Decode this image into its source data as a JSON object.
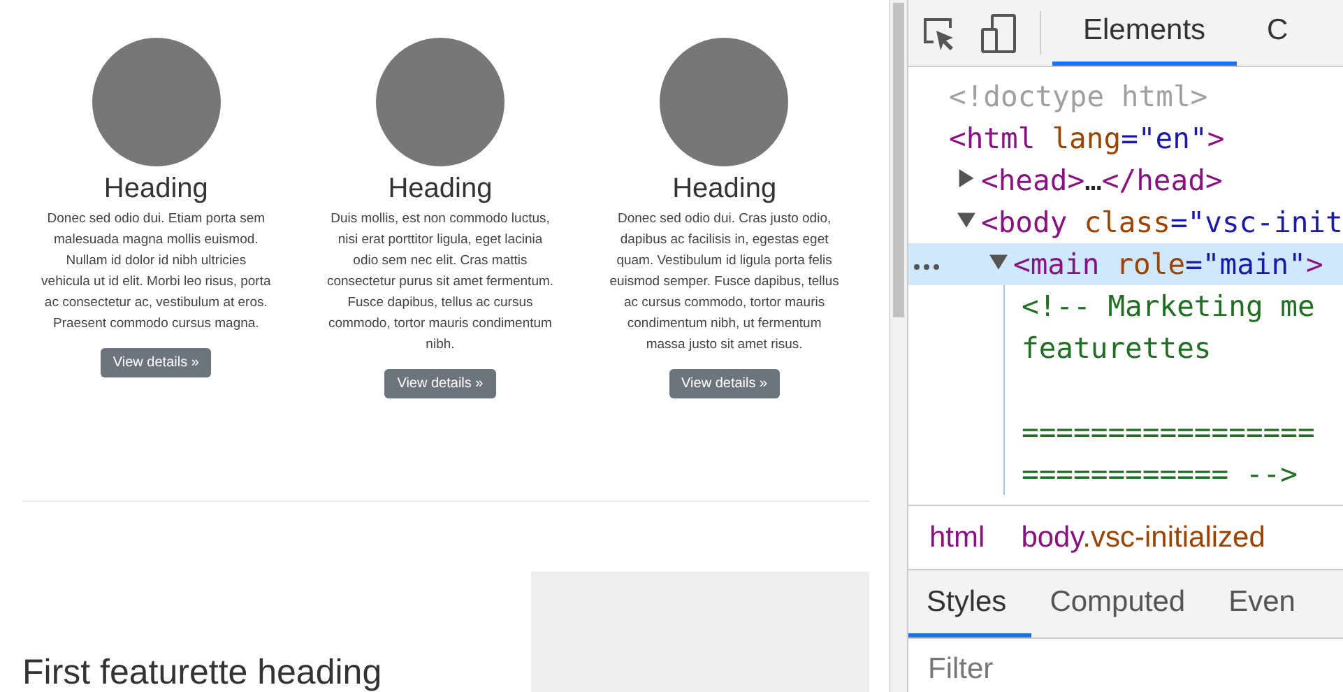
{
  "page": {
    "cards": [
      {
        "heading": "Heading",
        "text": "Donec sed odio dui. Etiam porta sem malesuada magna mollis euismod. Nullam id dolor id nibh ultricies vehicula ut id elit. Morbi leo risus, porta ac consectetur ac, vestibulum at eros. Praesent commodo cursus magna.",
        "button": "View details »"
      },
      {
        "heading": "Heading",
        "text": "Duis mollis, est non commodo luctus, nisi erat porttitor ligula, eget lacinia odio sem nec elit. Cras mattis consectetur purus sit amet fermentum. Fusce dapibus, tellus ac cursus commodo, tortor mauris condimentum nibh.",
        "button": "View details »"
      },
      {
        "heading": "Heading",
        "text": "Donec sed odio dui. Cras justo odio, dapibus ac facilisis in, egestas eget quam. Vestibulum id ligula porta felis euismod semper. Fusce dapibus, tellus ac cursus commodo, tortor mauris condimentum nibh, ut fermentum massa justo sit amet risus.",
        "button": "View details »"
      }
    ],
    "featurette_heading": "First featurette heading"
  },
  "devtools": {
    "tabs": [
      {
        "label": "Elements",
        "selected": true
      },
      {
        "label": "C",
        "selected": false
      }
    ],
    "tree": [
      {
        "doctype": "<!doctype html>",
        "selected": false
      },
      {
        "tag": "<html",
        "attributes": [
          {
            "name": "lang",
            "value": "=\"en\""
          }
        ],
        "end": ">",
        "selected": false,
        "children": [
          {
            "tag": "<head>",
            "content": "…",
            "closing": "</head>",
            "expanded": false,
            "selected": false
          },
          {
            "tag": "<body",
            "attributes": [
              {
                "name": "class",
                "value": "=\"vsc-init"
              }
            ],
            "expanded": true,
            "selected": false,
            "children": [
              {
                "tag": "<main",
                "attributes": [
                  {
                    "name": "role",
                    "value": "=\"main\""
                  }
                ],
                "end": ">",
                "expanded": true,
                "selected": true,
                "children": [
                  {
                    "comment_lines": [
                      {
                        "text": "<!-- Marketing me"
                      },
                      {
                        "text": "featurettes"
                      },
                      {
                        "text": "=================",
                        "blank_before": true
                      },
                      {
                        "text": "============ -->"
                      }
                    ],
                    "selected": false
                  }
                ]
              }
            ]
          }
        ]
      }
    ],
    "breadcrumbs": [
      {
        "tag": "html"
      },
      {
        "tag": "body",
        "class": ".vsc-initialized"
      }
    ],
    "pane_tabs": [
      {
        "label": "Styles",
        "selected": true
      },
      {
        "label": "Computed",
        "selected": false
      },
      {
        "label": "Even",
        "selected": false
      }
    ],
    "filter": {
      "placeholder": "Filter"
    }
  }
}
